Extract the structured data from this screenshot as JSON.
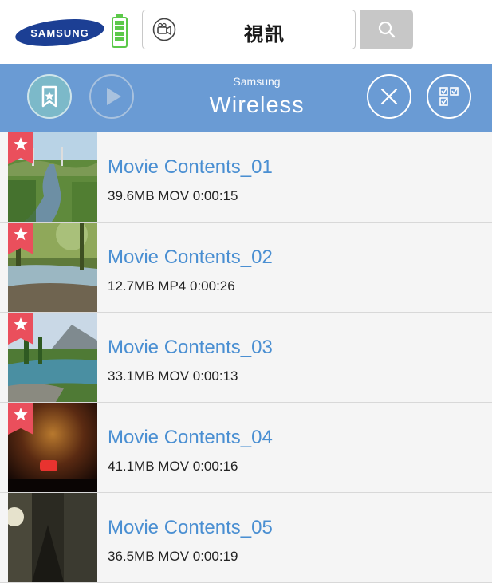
{
  "brand_logo": "SAMSUNG",
  "search": {
    "query": "視訊"
  },
  "header": {
    "subtitle": "Samsung",
    "title": "Wireless"
  },
  "colors": {
    "header_bg": "#6a9bd4",
    "title_text": "#4a8fd2",
    "flag": "#ea4f5c",
    "battery": "#5cc94a"
  },
  "icons": [
    "video-camera-icon",
    "search-icon",
    "bookmark-star-icon",
    "play-icon",
    "close-icon",
    "checklist-icon",
    "star-flag-icon"
  ],
  "videos": [
    {
      "title": "Movie Contents_01",
      "meta": "39.6MB  MOV  0:00:15",
      "starred": true
    },
    {
      "title": "Movie Contents_02",
      "meta": "12.7MB  MP4  0:00:26",
      "starred": true
    },
    {
      "title": "Movie Contents_03",
      "meta": "33.1MB  MOV  0:00:13",
      "starred": true
    },
    {
      "title": "Movie Contents_04",
      "meta": "41.1MB  MOV  0:00:16",
      "starred": true
    },
    {
      "title": "Movie Contents_05",
      "meta": "36.5MB  MOV  0:00:19",
      "starred": false
    }
  ]
}
